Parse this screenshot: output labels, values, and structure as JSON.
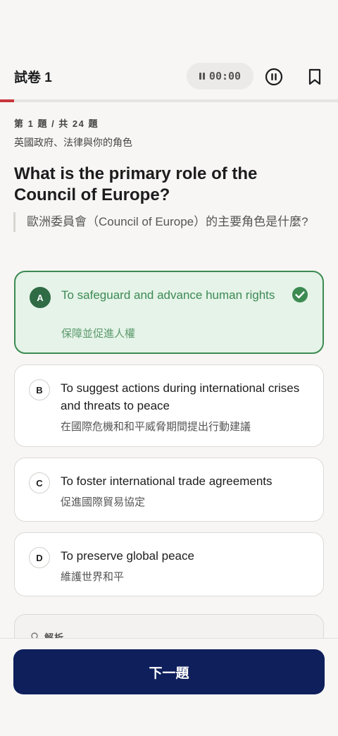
{
  "header": {
    "title": "試卷 1",
    "timer": "00:00"
  },
  "progress": {
    "fraction": 0.0417,
    "color": "#c8373c"
  },
  "question": {
    "count_label": "第 1 題 / 共 24 題",
    "category": "英國政府、法律與你的角色",
    "text_en": "What is the primary role of the Council of Europe?",
    "text_zh": "歐洲委員會（Council of Europe）的主要角色是什麼?"
  },
  "options": [
    {
      "letter": "A",
      "en": "To safeguard and advance human rights",
      "zh": "保障並促進人權",
      "correct": true
    },
    {
      "letter": "B",
      "en": "To suggest actions during international crises and threats to peace",
      "zh": "在國際危機和和平威脅期間提出行動建議",
      "correct": false
    },
    {
      "letter": "C",
      "en": "To foster international trade agreements",
      "zh": "促進國際貿易協定",
      "correct": false
    },
    {
      "letter": "D",
      "en": "To preserve global peace",
      "zh": "維護世界和平",
      "correct": false
    }
  ],
  "analysis": {
    "label": "解析",
    "icon": "lightbulb-icon"
  },
  "footer": {
    "next_label": "下一題"
  },
  "colors": {
    "correct": "#3c8a52",
    "primary": "#0f1f5c",
    "accent": "#c8373c"
  }
}
